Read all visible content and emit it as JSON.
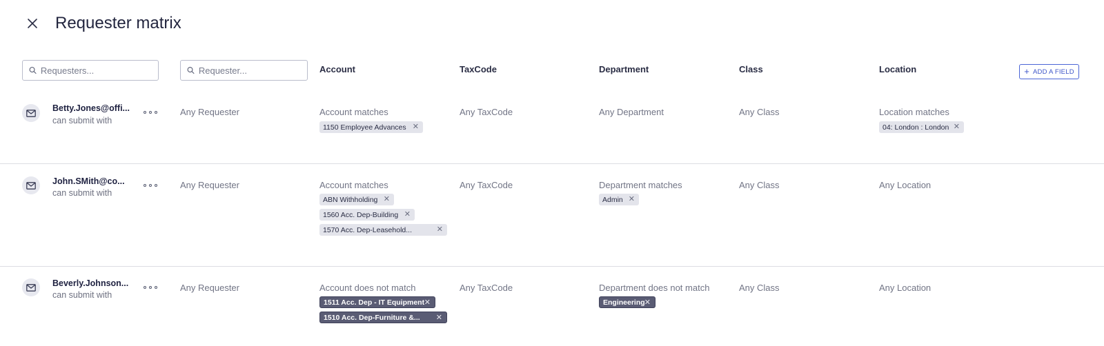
{
  "header": {
    "title": "Requester matrix"
  },
  "filters": {
    "requesters_placeholder": "Requesters...",
    "requester_placeholder": "Requester..."
  },
  "columns": [
    "Account",
    "TaxCode",
    "Department",
    "Class",
    "Location"
  ],
  "add_field_label": "ADD A FIELD",
  "rows": [
    {
      "email": "Betty.Jones@offi...",
      "subtext": "can submit with",
      "requester": "Any Requester",
      "account": {
        "text": "Account matches",
        "chips": [
          "1150 Employee Advances"
        ]
      },
      "taxcode": {
        "text": "Any TaxCode"
      },
      "department": {
        "text": "Any Department",
        "chips": []
      },
      "class": {
        "text": "Any Class"
      },
      "location": {
        "text": "Location matches",
        "chips": [
          "04: London : London"
        ]
      }
    },
    {
      "email": "John.SMith@co...",
      "subtext": "can submit with",
      "requester": "Any Requester",
      "account": {
        "text": "Account matches",
        "chips": [
          "ABN Withholding",
          "1560 Acc. Dep-Building",
          "1570 Acc. Dep-Leasehold..."
        ]
      },
      "taxcode": {
        "text": "Any TaxCode"
      },
      "department": {
        "text": "Department matches",
        "chips": [
          "Admin"
        ]
      },
      "class": {
        "text": "Any Class"
      },
      "location": {
        "text": "Any Location",
        "chips": []
      }
    },
    {
      "email": "Beverly.Johnson...",
      "subtext": "can submit with",
      "requester": "Any Requester",
      "account": {
        "text": "Account does not match",
        "chips": [
          "1511 Acc. Dep - IT Equipment",
          "1510 Acc. Dep-Furniture &..."
        ]
      },
      "taxcode": {
        "text": "Any TaxCode"
      },
      "department": {
        "text": "Department does not match",
        "chips": [
          "Engineering"
        ]
      },
      "class": {
        "text": "Any Class"
      },
      "location": {
        "text": "Any Location",
        "chips": []
      }
    }
  ],
  "colors": {
    "accent": "#3d55c8",
    "chip_bg": "#e3e4eb",
    "chip_dark_bg": "#5a5c74",
    "divider": "#dcdde3"
  },
  "icons": {
    "close": "close-icon",
    "search": "search-icon",
    "mail": "mail-icon",
    "more": "more-horizontal-icon",
    "plus": "plus-icon",
    "remove": "remove-x-icon"
  }
}
